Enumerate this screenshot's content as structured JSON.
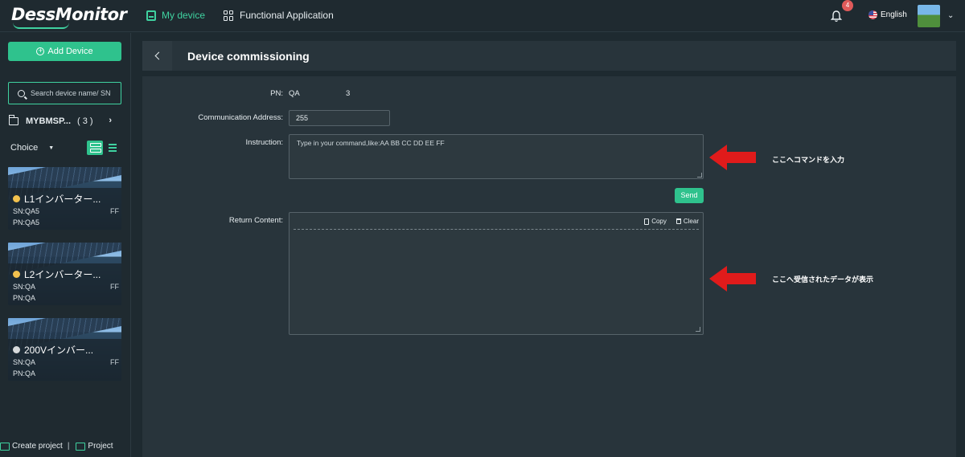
{
  "brand": {
    "logo_text": "DessMonitor"
  },
  "topnav": {
    "items": [
      {
        "label": "My device",
        "icon": "device-icon",
        "active": true
      },
      {
        "label": "Functional Application",
        "icon": "grid-icon",
        "active": false
      }
    ],
    "notifications_count": "4",
    "language": "English"
  },
  "sidebar": {
    "add_device_label": "Add Device",
    "search_placeholder": "Search device name/ SN",
    "folder": {
      "name": "MYBMSP...",
      "count": "( 3 )"
    },
    "choice_label": "Choice",
    "devices": [
      {
        "name": "L1インバーター...",
        "sn": "SN:QA5",
        "pn": "PN:QA5",
        "ff": "FF",
        "status_color": "#f2c14e"
      },
      {
        "name": "L2インバーター...",
        "sn": "SN:QA",
        "pn": "PN:QA",
        "ff": "FF",
        "status_color": "#f2c14e"
      },
      {
        "name": "200Vインバー...",
        "sn": "SN:QA",
        "pn": "PN:QA",
        "ff": "FF",
        "status_color": "#d6d9db"
      }
    ],
    "footer": {
      "create_project": "Create project",
      "project": "Project"
    }
  },
  "page": {
    "title": "Device commissioning",
    "pn_label": "PN:",
    "pn_value": "QA",
    "pn_suffix": "3",
    "comm_address_label": "Communication Address:",
    "comm_address_value": "255",
    "instruction_label": "Instruction:",
    "instruction_placeholder": "Type in your command,like:AA BB CC DD EE FF",
    "send_label": "Send",
    "return_label": "Return Content:",
    "copy_label": "Copy",
    "clear_label": "Clear"
  },
  "annotations": {
    "instruction_note": "ここへコマンドを入力",
    "return_note": "ここへ受信されたデータが表示",
    "arrow_color": "#e01b1b"
  },
  "colors": {
    "accent": "#3fd2a0",
    "button": "#2fc28d",
    "background": "#1e2a30",
    "panel": "#28343b"
  }
}
